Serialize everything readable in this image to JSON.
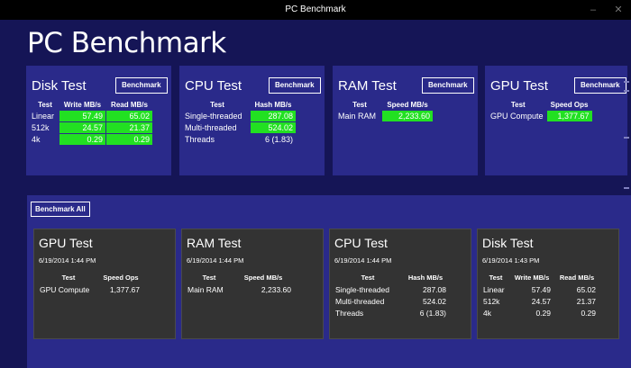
{
  "window": {
    "title": "PC Benchmark"
  },
  "app": {
    "title": "PC Benchmark"
  },
  "benchmark_label": "Benchmark",
  "benchmark_all_label": "Benchmark All",
  "tiles": {
    "disk": {
      "title": "Disk Test",
      "headers": [
        "Test",
        "Write MB/s",
        "Read MB/s"
      ],
      "rows": [
        [
          "Linear",
          "57.49",
          "65.02"
        ],
        [
          "512k",
          "24.57",
          "21.37"
        ],
        [
          "4k",
          "0.29",
          "0.29"
        ]
      ]
    },
    "cpu": {
      "title": "CPU Test",
      "headers": [
        "Test",
        "Hash MB/s"
      ],
      "rows": [
        [
          "Single-threaded",
          "287.08"
        ],
        [
          "Multi-threaded",
          "524.02"
        ],
        [
          "Threads",
          "6 (1.83)"
        ]
      ]
    },
    "ram": {
      "title": "RAM Test",
      "headers": [
        "Test",
        "Speed MB/s"
      ],
      "rows": [
        [
          "Main RAM",
          "2,233.60"
        ]
      ]
    },
    "gpu": {
      "title": "GPU Test",
      "headers": [
        "Test",
        "Speed Ops"
      ],
      "rows": [
        [
          "GPU Compute",
          "1,377.67"
        ]
      ]
    }
  },
  "history": {
    "gpu": {
      "title": "GPU Test",
      "date": "6/19/2014 1:44 PM",
      "headers": [
        "Test",
        "Speed Ops"
      ],
      "rows": [
        [
          "GPU Compute",
          "1,377.67"
        ]
      ]
    },
    "ram": {
      "title": "RAM Test",
      "date": "6/19/2014 1:44 PM",
      "headers": [
        "Test",
        "Speed MB/s"
      ],
      "rows": [
        [
          "Main RAM",
          "2,233.60"
        ]
      ]
    },
    "cpu": {
      "title": "CPU Test",
      "date": "6/19/2014 1:44 PM",
      "headers": [
        "Test",
        "Hash MB/s"
      ],
      "rows": [
        [
          "Single-threaded",
          "287.08"
        ],
        [
          "Multi-threaded",
          "524.02"
        ],
        [
          "Threads",
          "6 (1.83)"
        ]
      ]
    },
    "disk": {
      "title": "Disk Test",
      "date": "6/19/2014 1:43 PM",
      "headers": [
        "Test",
        "Write MB/s",
        "Read MB/s"
      ],
      "rows": [
        [
          "Linear",
          "57.49",
          "65.02"
        ],
        [
          "512k",
          "24.57",
          "21.37"
        ],
        [
          "4k",
          "0.29",
          "0.29"
        ]
      ]
    }
  },
  "colors": {
    "background": "#151556",
    "tile": "#2a2a8a",
    "card": "#333333",
    "value_highlight": "#22e022"
  }
}
